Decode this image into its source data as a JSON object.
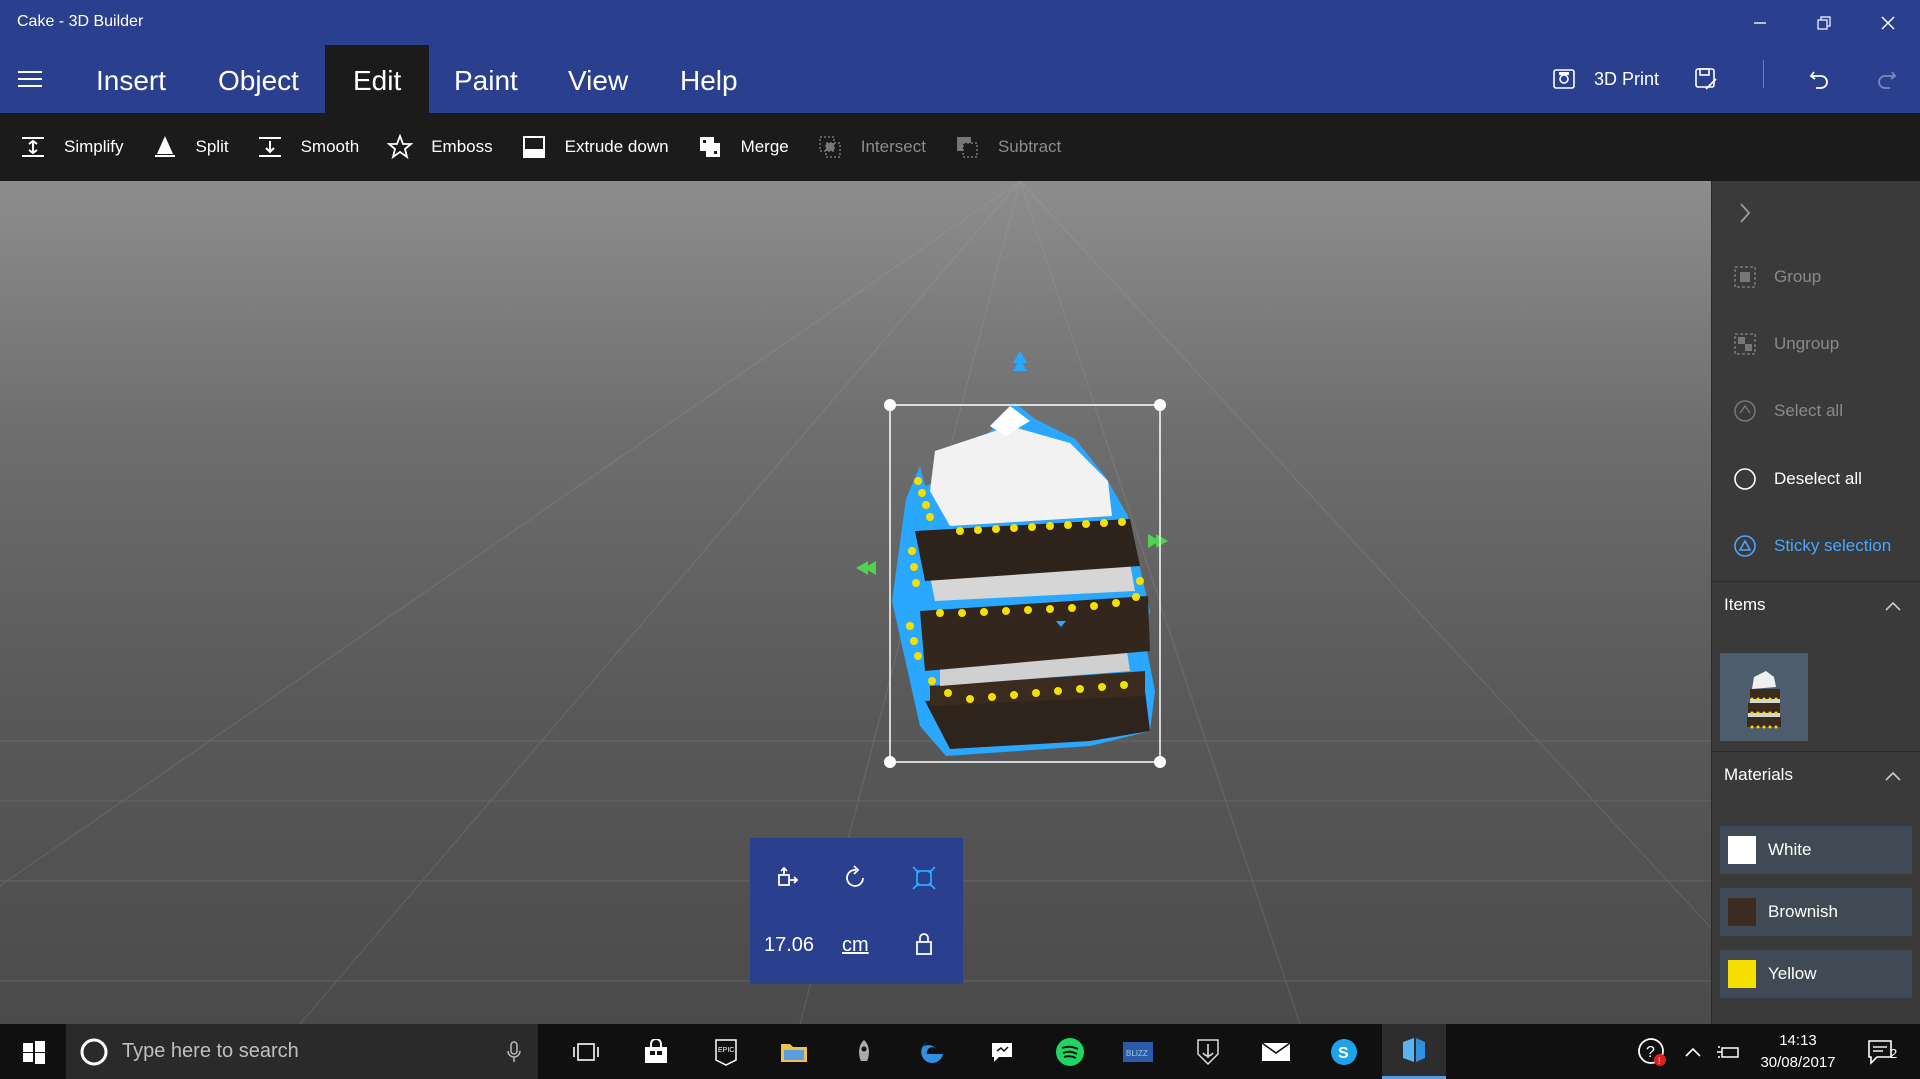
{
  "window": {
    "title": "Cake - 3D Builder"
  },
  "menu": {
    "tabs": [
      "Insert",
      "Object",
      "Edit",
      "Paint",
      "View",
      "Help"
    ],
    "active": "Edit",
    "print_label": "3D Print"
  },
  "toolbar": {
    "simplify": "Simplify",
    "split": "Split",
    "smooth": "Smooth",
    "emboss": "Emboss",
    "extrude_down": "Extrude down",
    "merge": "Merge",
    "intersect": "Intersect",
    "subtract": "Subtract"
  },
  "sidepanel": {
    "group": "Group",
    "ungroup": "Ungroup",
    "select_all": "Select all",
    "deselect_all": "Deselect all",
    "sticky_selection": "Sticky selection",
    "items_title": "Items",
    "materials_title": "Materials",
    "materials": [
      {
        "name": "White",
        "color": "#ffffff"
      },
      {
        "name": "Brownish",
        "color": "#3b2a1e"
      },
      {
        "name": "Yellow",
        "color": "#f5e000"
      }
    ]
  },
  "transform": {
    "value": "17.06",
    "unit": "cm"
  },
  "taskbar": {
    "search_placeholder": "Type here to search",
    "time": "14:13",
    "date": "30/08/2017",
    "notification_count": "2"
  },
  "colors": {
    "accent": "#2b3f8f",
    "selection": "#2aa8ff"
  }
}
